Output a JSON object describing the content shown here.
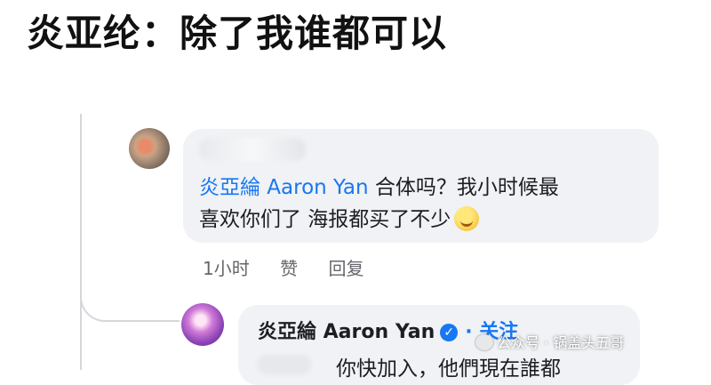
{
  "caption": "炎亚纶：除了我谁都可以",
  "comment": {
    "mention": "炎亞綸 Aaron Yan",
    "text_line1": " 合体吗？我小时候最",
    "text_line2": "喜欢你们了 海报都买了不少",
    "time": "1小时",
    "like_label": "赞",
    "reply_label": "回复"
  },
  "reply": {
    "author": "炎亞綸 Aaron Yan",
    "follow_label": "· 关注",
    "text": "你快加入，他們現在誰都"
  },
  "watermark": "公众号 · 锅盖头五哥",
  "colors": {
    "link": "#1877f2",
    "bubble": "#f0f2f5",
    "secondary_text": "#65676b"
  }
}
